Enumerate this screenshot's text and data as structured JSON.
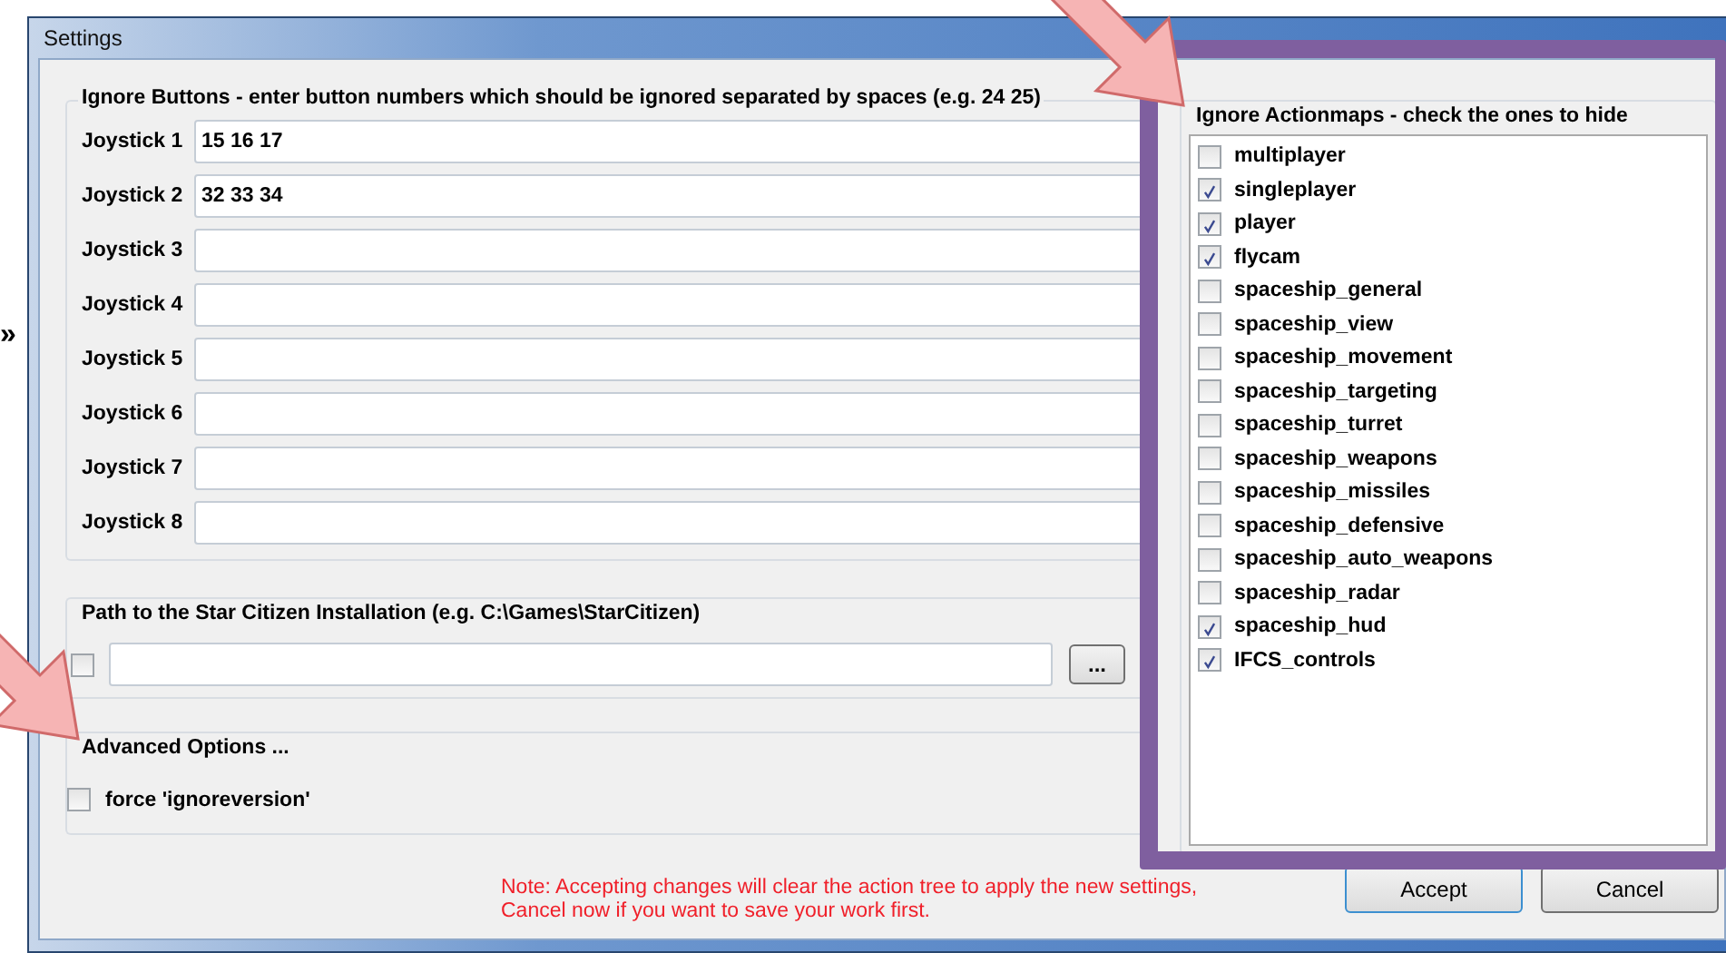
{
  "side_marker": "»",
  "window": {
    "title": "Settings"
  },
  "ignore_buttons": {
    "title": "Ignore Buttons - enter button numbers which should be ignored separated by spaces (e.g. 24 25)",
    "joysticks": [
      {
        "label": "Joystick 1",
        "value": "15 16 17"
      },
      {
        "label": "Joystick 2",
        "value": "32 33 34"
      },
      {
        "label": "Joystick 3"
      },
      {
        "label": "Joystick 4"
      },
      {
        "label": "Joystick 5"
      },
      {
        "label": "Joystick 6"
      },
      {
        "label": "Joystick 7"
      },
      {
        "label": "Joystick 8"
      }
    ]
  },
  "path_group": {
    "title": "Path to the Star Citizen Installation (e.g. C:\\Games\\StarCitizen)",
    "checked": false,
    "browse_button": "..."
  },
  "advanced": {
    "title": "Advanced Options ...",
    "options": [
      {
        "label": "force 'ignoreversion'",
        "checked": false
      }
    ]
  },
  "actionmaps": {
    "title": "Ignore Actionmaps - check the ones to hide",
    "items": [
      {
        "label": "multiplayer",
        "checked": false
      },
      {
        "label": "singleplayer",
        "checked": true
      },
      {
        "label": "player",
        "checked": true
      },
      {
        "label": "flycam",
        "checked": true
      },
      {
        "label": "spaceship_general",
        "checked": false
      },
      {
        "label": "spaceship_view",
        "checked": false
      },
      {
        "label": "spaceship_movement",
        "checked": false
      },
      {
        "label": "spaceship_targeting",
        "checked": false
      },
      {
        "label": "spaceship_turret",
        "checked": false
      },
      {
        "label": "spaceship_weapons",
        "checked": false
      },
      {
        "label": "spaceship_missiles",
        "checked": false
      },
      {
        "label": "spaceship_defensive",
        "checked": false
      },
      {
        "label": "spaceship_auto_weapons",
        "checked": false
      },
      {
        "label": "spaceship_radar",
        "checked": false
      },
      {
        "label": "spaceship_hud",
        "checked": true
      },
      {
        "label": "IFCS_controls",
        "checked": true
      }
    ]
  },
  "note": [
    "Note: Accepting changes will clear the action tree to apply the new settings,",
    "Cancel now if you want to save your work first."
  ],
  "buttons": [
    {
      "label": "Accept",
      "default": true
    },
    {
      "label": "Cancel",
      "default": false
    }
  ]
}
